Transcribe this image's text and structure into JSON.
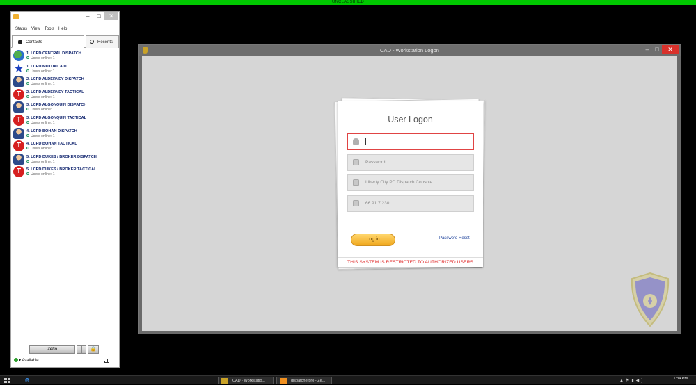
{
  "banner": {
    "text": "UNCLASSIFIED"
  },
  "chat": {
    "menu": [
      "Status",
      "View",
      "Tools",
      "Help"
    ],
    "tabs": {
      "contacts": "Contacts",
      "recents": "Recents"
    },
    "contacts": [
      {
        "name": "1. LCPD CENTRAL DISPATCH",
        "status": "Users online: 1",
        "icon": "globe-icon"
      },
      {
        "name": "1. LCPD MUTUAL AID",
        "status": "Users online: 1",
        "icon": "star-icon"
      },
      {
        "name": "2. LCPD ALDERNEY DISPATCH",
        "status": "Users online: 1",
        "icon": "officer-icon"
      },
      {
        "name": "2. LCPD ALDERNEY TACTICAL",
        "status": "Users online: 1",
        "icon": "tactical-icon"
      },
      {
        "name": "3. LCPD ALGONQUIN DISPATCH",
        "status": "Users online: 1",
        "icon": "officer-icon"
      },
      {
        "name": "3. LCPD ALGONQUIN TACTICAL",
        "status": "Users online: 1",
        "icon": "tactical-icon"
      },
      {
        "name": "4. LCPD BOHAN DISPATCH",
        "status": "Users online: 1",
        "icon": "officer-icon"
      },
      {
        "name": "4. LCPD BOHAN TACTICAL",
        "status": "Users online: 1",
        "icon": "tactical-icon"
      },
      {
        "name": "5. LCPD DUKES / BROKER DISPATCH",
        "status": "Users online: 1",
        "icon": "officer-icon"
      },
      {
        "name": "5. LCPD DUKES / BROKER TACTICAL",
        "status": "Users online: 1",
        "icon": "tactical-icon"
      }
    ],
    "brand": "Zello",
    "status": "Available"
  },
  "cad": {
    "window_title": "CAD - Workstation Logon",
    "login_title": "User Logon",
    "username_value": "",
    "password_placeholder": "Password",
    "console_placeholder": "Liberty City PD Dispatch Console",
    "ip_placeholder": "66.91.7.230",
    "login_button": "Log in",
    "password_reset": "Password Reset",
    "restricted": "THIS SYSTEM IS RESTRICTED TO AUTHORIZED USERS"
  },
  "taskbar": {
    "tasks": [
      "CAD - Workstatio...",
      "dispatcherpro - Ze..."
    ],
    "clock": "1:34 PM"
  },
  "colors": {
    "banner": "#00c800",
    "restricted": "#e03030",
    "accent_button": "#f0a81e",
    "active_field_border": "#e04444"
  }
}
